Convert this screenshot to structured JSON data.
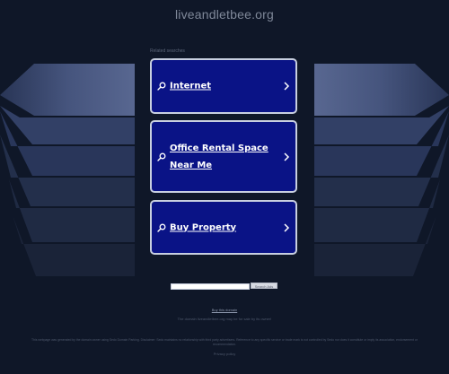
{
  "header": {
    "domain_title": "liveandletbee.org"
  },
  "related": {
    "label": "Related searches",
    "links": [
      {
        "label": "Internet"
      },
      {
        "label": "Office Rental Space Near Me"
      },
      {
        "label": "Buy Property"
      }
    ]
  },
  "search": {
    "input_value": "",
    "button_label": "Search Ads"
  },
  "footer": {
    "buy_domain": "Buy this domain",
    "owner_notice": "The domain liveandletbee.org may be for sale by its owner!",
    "disclaimer": "This webpage was generated by the domain owner using Sedo Domain Parking. Disclaimer: Sedo maintains no relationship with third party advertisers. Reference to any specific service or trade mark is not controlled by Sedo nor does it constitute or imply its association, endorsement or recommendation.",
    "privacy": "Privacy policy"
  },
  "colors": {
    "background": "#0f1728",
    "card_fill": "#0a1386",
    "card_border": "#c8cfe0",
    "deco_light": "#4a5a86",
    "deco_dark": "#1c2740"
  },
  "icons": {
    "card_left": "search-icon",
    "card_right": "chevron-right-icon"
  }
}
